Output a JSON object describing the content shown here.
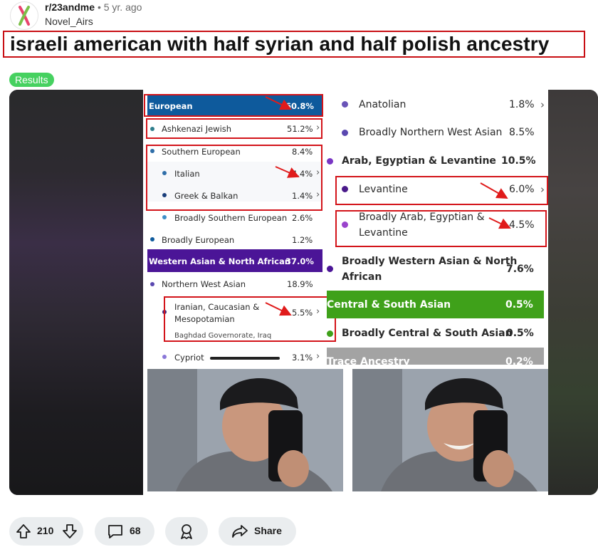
{
  "post": {
    "subreddit": "r/23andme",
    "separator": "•",
    "age": "5 yr. ago",
    "author": "Novel_Airs",
    "title": "israeli american with half syrian and half polish ancestry",
    "flair": "Results"
  },
  "colors": {
    "european_band": "#0e5a9c",
    "western_asian_band": "#4b1597",
    "central_south_asian_band": "#3fa11a",
    "trace_band": "#a3a3a3",
    "highlight_box": "#d3141a",
    "flair": "#46d160"
  },
  "results_left": {
    "european": {
      "label": "European",
      "pct": "60.8%"
    },
    "ashkenazi": {
      "label": "Ashkenazi Jewish",
      "pct": "51.2%"
    },
    "southern_european": {
      "label": "Southern European",
      "pct": "8.4%"
    },
    "italian": {
      "label": "Italian",
      "pct": "4.4%"
    },
    "greek_balkan": {
      "label": "Greek & Balkan",
      "pct": "1.4%"
    },
    "broadly_southern_european": {
      "label": "Broadly Southern European",
      "pct": "2.6%"
    },
    "broadly_european": {
      "label": "Broadly European",
      "pct": "1.2%"
    },
    "western_asian": {
      "label": "Western Asian & North African",
      "pct": "37.0%"
    },
    "northern_west_asian": {
      "label": "Northern West Asian",
      "pct": "18.9%"
    },
    "iranian_line1": "Iranian, Caucasian &",
    "iranian_line2": "Mesopotamian",
    "iranian_pct": "5.5%",
    "iranian_location": "Baghdad Governorate, Iraq",
    "cypriot": {
      "label": "Cypriot",
      "pct": "3.1%"
    }
  },
  "results_right": {
    "anatolian": {
      "label": "Anatolian",
      "pct": "1.8%"
    },
    "broadly_northern_west_asian": {
      "label": "Broadly Northern West Asian",
      "pct": "8.5%"
    },
    "arab_egyptian_levantine": {
      "label": "Arab, Egyptian & Levantine",
      "pct": "10.5%"
    },
    "levantine": {
      "label": "Levantine",
      "pct": "6.0%"
    },
    "broadly_arab_line1": "Broadly Arab, Egyptian &",
    "broadly_arab_line2": "Levantine",
    "broadly_arab_pct": "4.5%",
    "broadly_wana_line1": "Broadly Western Asian & North",
    "broadly_wana_line2": "African",
    "broadly_wana_pct": "7.6%",
    "central_south_asian": {
      "label": "Central & South Asian",
      "pct": "0.5%"
    },
    "broadly_central_south_asian": {
      "label": "Broadly Central & South Asian",
      "pct": "0.5%"
    },
    "trace": {
      "label": "Trace Ancestry",
      "pct": "0.2%"
    }
  },
  "actions": {
    "upvotes": "210",
    "comments": "68",
    "share": "Share"
  }
}
